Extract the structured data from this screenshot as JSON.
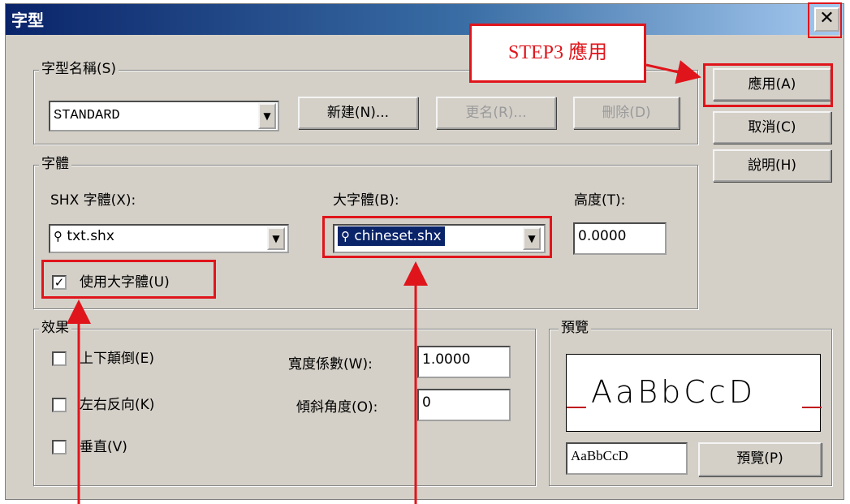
{
  "title": "字型",
  "close_glyph": "✕",
  "style_name": {
    "legend": "字型名稱(S)",
    "value": "STANDARD",
    "new_button": "新建(N)...",
    "rename_button": "更名(R)...",
    "delete_button": "刪除(D)"
  },
  "side_buttons": {
    "apply": "應用(A)",
    "cancel": "取消(C)",
    "help": "說明(H)"
  },
  "font": {
    "legend": "字體",
    "shx_label": "SHX 字體(X):",
    "shx_value": "txt.shx",
    "bigfont_label": "大字體(B):",
    "bigfont_value": "chineset.shx",
    "height_label": "高度(T):",
    "height_value": "0.0000",
    "use_bigfont_label": "使用大字體(U)",
    "use_bigfont_checked": true
  },
  "effects": {
    "legend": "效果",
    "upside_down": "上下顛倒(E)",
    "backwards": "左右反向(K)",
    "vertical": "垂直(V)",
    "width_factor_label": "寬度係數(W):",
    "width_factor_value": "1.0000",
    "oblique_label": "傾斜角度(O):",
    "oblique_value": "0"
  },
  "preview": {
    "legend": "預覽",
    "sample": "AaBbCcD",
    "text_value": "AaBbCcD",
    "button": "預覽(P)"
  },
  "annotation": {
    "step3": "STEP3 應用",
    "color": "#e0151b"
  },
  "colors": {
    "titlebar_start": "#0a246a",
    "dialog_face": "#d4d0c8",
    "selection": "#0a246a"
  }
}
